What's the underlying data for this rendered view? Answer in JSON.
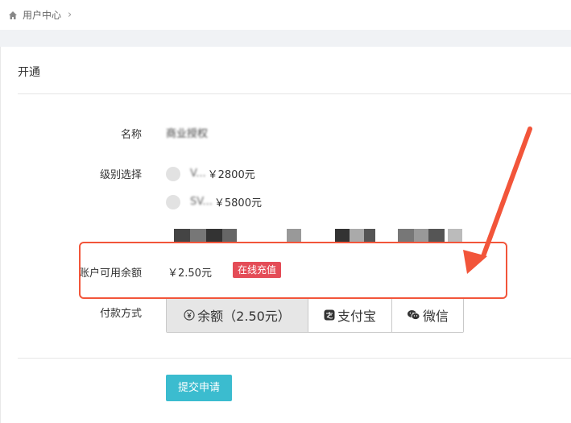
{
  "breadcrumb": {
    "home_icon": "home-icon",
    "label": "用户中心",
    "chevron": "›"
  },
  "panel": {
    "title": "开通"
  },
  "form": {
    "name_label": "名称",
    "name_value": "商业授权",
    "level_label": "级别选择",
    "levels": [
      {
        "masked_text": "V... ",
        "price": "￥2800元"
      },
      {
        "masked_text": "SV...",
        "price": "￥5800元"
      }
    ],
    "balance_label": "账户可用余额",
    "balance_value": "￥2.50元",
    "recharge_label": "在线充值",
    "pay_label": "付款方式",
    "pay_options": [
      {
        "icon": "yen-circle-icon",
        "label": "余额（2.50元）",
        "selected": true
      },
      {
        "icon": "alipay-icon",
        "label": "支付宝",
        "selected": false
      },
      {
        "icon": "wechat-icon",
        "label": "微信",
        "selected": false
      }
    ],
    "submit_label": "提交申请"
  },
  "colors": {
    "accent": "#3bbccf",
    "recharge": "#e44c57",
    "annotation": "#f2553a"
  }
}
